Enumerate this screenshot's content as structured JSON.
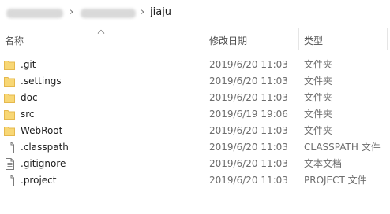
{
  "breadcrumb": {
    "current": "jiaju"
  },
  "header": {
    "name": "名称",
    "date": "修改日期",
    "type": "类型"
  },
  "files": [
    {
      "name": ".git",
      "date": "2019/6/20 11:03",
      "type": "文件夹",
      "icon": "folder-icon"
    },
    {
      "name": ".settings",
      "date": "2019/6/20 11:03",
      "type": "文件夹",
      "icon": "folder-icon"
    },
    {
      "name": "doc",
      "date": "2019/6/20 11:03",
      "type": "文件夹",
      "icon": "folder-icon"
    },
    {
      "name": "src",
      "date": "2019/6/19 19:06",
      "type": "文件夹",
      "icon": "folder-icon"
    },
    {
      "name": "WebRoot",
      "date": "2019/6/20 11:03",
      "type": "文件夹",
      "icon": "folder-icon"
    },
    {
      "name": ".classpath",
      "date": "2019/6/20 11:03",
      "type": "CLASSPATH 文件",
      "icon": "file-icon"
    },
    {
      "name": ".gitignore",
      "date": "2019/6/20 11:03",
      "type": "文本文档",
      "icon": "text-file-icon"
    },
    {
      "name": ".project",
      "date": "2019/6/20 11:03",
      "type": "PROJECT 文件",
      "icon": "file-icon"
    }
  ],
  "colors": {
    "folder": "#f8d775",
    "folder_dark": "#e5b84d",
    "text_primary": "#1e1e1e",
    "text_secondary": "#6d6d6d"
  }
}
